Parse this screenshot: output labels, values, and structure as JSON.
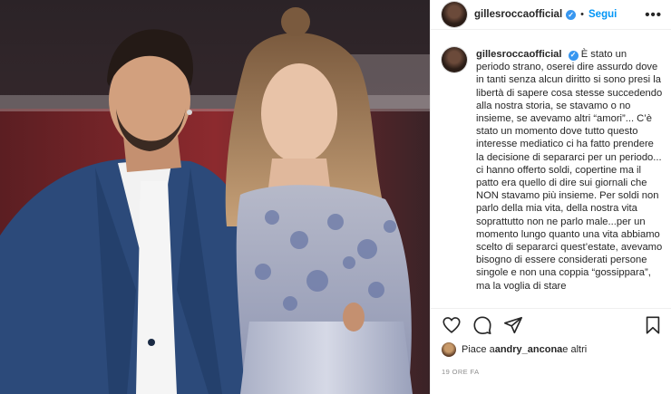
{
  "post": {
    "username": "gillesroccaofficial",
    "verified_mark": "✓",
    "separator": "•",
    "follow_label": "Segui",
    "more_label": "•••"
  },
  "caption": {
    "username": "gillesroccaofficial",
    "text": "È stato un periodo strano, oserei dire assurdo dove in tanti senza alcun diritto si sono presi la libertà di sapere cosa stesse succedendo alla nostra storia, se stavamo o no insieme, se avevamo altri “amori”... C’è stato un momento dove tutto questo interesse mediatico ci ha fatto prendere la decisione di separarci per un periodo... ci hanno offerto soldi, copertine ma il patto era quello di dire sui giornali che NON stavamo più insieme. Per soldi non parlo della mia vita, della nostra vita soprattutto non ne parlo male...per un momento lungo quanto una vita abbiamo scelto di separarci quest’estate, avevamo bisogno di essere considerati persone singole e non una coppia “gossippara”, ma la voglia di stare"
  },
  "actions": {
    "like_icon": "heart-icon",
    "comment_icon": "comment-icon",
    "share_icon": "share-icon",
    "save_icon": "bookmark-icon"
  },
  "likes": {
    "prefix": "Piace a ",
    "user": "andry_ancona",
    "suffix": " e altri"
  },
  "timestamp": "19 ORE FA",
  "colors": {
    "accent": "#0095f6",
    "verified": "#3897f0",
    "text": "#262626",
    "muted": "#8e8e8e",
    "border": "#efefef"
  }
}
